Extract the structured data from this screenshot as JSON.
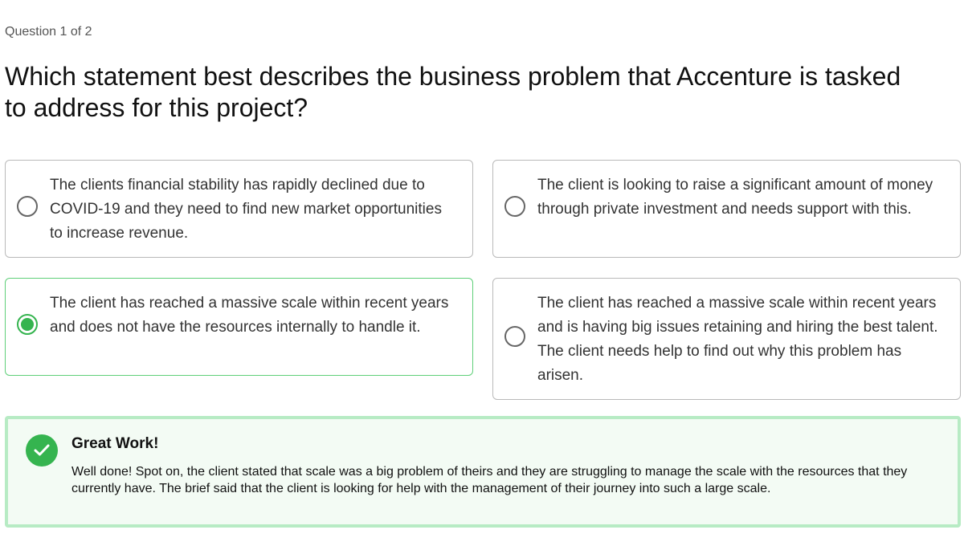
{
  "quiz": {
    "counter": "Question 1 of 2",
    "question": "Which statement best describes the business problem that Accenture is tasked to address for this project?",
    "options": [
      {
        "text": "The clients financial stability has rapidly declined due to COVID-19 and they need to find new market opportunities to increase revenue.",
        "selected": false
      },
      {
        "text": "The client is looking to raise a significant amount of money through private investment and needs support with this.",
        "selected": false
      },
      {
        "text": "The client has reached a massive scale within recent years and does not have the resources internally to handle it.",
        "selected": true
      },
      {
        "text": "The client has reached a massive scale within recent years and is having big issues retaining and hiring the best talent. The client needs help to find out why this problem has arisen.",
        "selected": false
      }
    ]
  },
  "feedback": {
    "icon": "checkmark-icon",
    "title": "Great Work!",
    "body": "Well done! Spot on, the client stated that scale was a big problem of theirs and they are struggling to manage the scale with the resources that they currently have. The brief said that the client is looking for help with the management of their journey into such a large scale."
  },
  "colors": {
    "accent_green": "#35b44f",
    "selected_border": "#5ecf78",
    "feedback_border": "#b7ebc4",
    "feedback_background": "#f3fbf4",
    "option_border": "#b9b9b9"
  }
}
